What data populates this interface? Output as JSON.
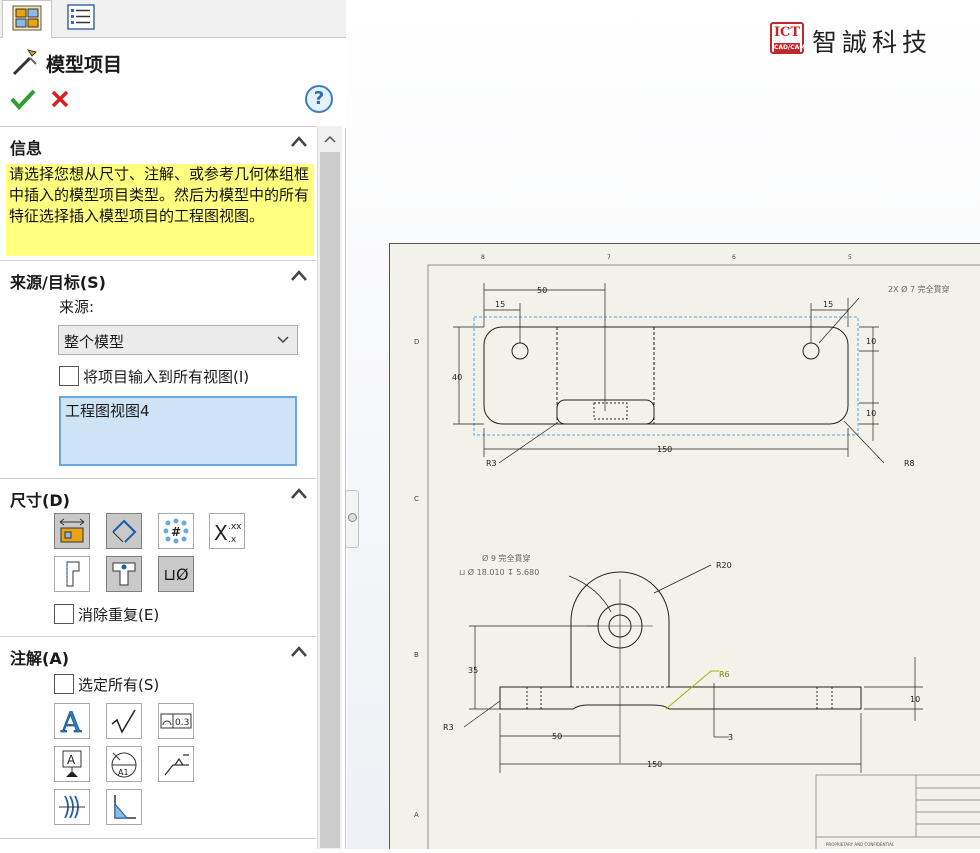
{
  "tabs": [
    {
      "name": "feature-manager-tab",
      "icon": "feature-manager-icon"
    },
    {
      "name": "property-manager-tab",
      "icon": "property-manager-icon"
    }
  ],
  "header": {
    "title": "模型项目",
    "help_label": "?",
    "ok_icon": "checkmark-icon",
    "cancel_icon": "close-icon"
  },
  "info": {
    "title": "信息",
    "text": "请选择您想从尺寸、注解、或参考几何体组框中插入的模型项目类型。然后为模型中的所有特征选择插入模型项目的工程图视图。"
  },
  "source": {
    "title": "来源/目标(S)",
    "source_label": "来源:",
    "source_value": "整个模型",
    "import_all_label": "将项目输入到所有视图(I)",
    "import_all_checked": false,
    "target_view": "工程图视图4"
  },
  "dimensions": {
    "title": "尺寸(D)",
    "eliminate_dup_label": "消除重复(E)",
    "eliminate_dup_checked": false,
    "tools": [
      {
        "name": "marked-for-drawing-icon",
        "active": true
      },
      {
        "name": "not-marked-for-drawing-icon",
        "active": true
      },
      {
        "name": "instance-count-icon",
        "active": false
      },
      {
        "name": "tolerance-dimension-icon",
        "label": "X.xx",
        "active": false
      },
      {
        "name": "hole-wizard-profile-icon",
        "active": false
      },
      {
        "name": "hole-wizard-locations-icon",
        "active": true
      },
      {
        "name": "hole-callout-icon",
        "label": "⊔Ø",
        "active": true
      }
    ]
  },
  "annotations": {
    "title": "注解(A)",
    "select_all_label": "选定所有(S)",
    "select_all_checked": false,
    "tools": [
      {
        "name": "note-icon"
      },
      {
        "name": "surface-finish-icon"
      },
      {
        "name": "geometric-tolerance-icon",
        "label": "0.3"
      },
      {
        "name": "datum-feature-icon",
        "label": "A"
      },
      {
        "name": "datum-target-icon",
        "label": "A1"
      },
      {
        "name": "weld-symbol-icon"
      },
      {
        "name": "cosmetic-thread-icon"
      },
      {
        "name": "weld-bead-icon"
      }
    ]
  },
  "logo": {
    "badge": "ICT",
    "badge_sub": "CAD/CAM",
    "company": "智誠科技"
  },
  "drawing": {
    "zone_letters": [
      "D",
      "C",
      "B",
      "A"
    ],
    "zone_numbers": [
      "8",
      "7",
      "6",
      "5"
    ],
    "top_view": {
      "dims": [
        "50",
        "15",
        "15",
        "40",
        "10",
        "10",
        "150"
      ],
      "radius_left": "R3",
      "radius_right": "R8",
      "hole_note": "2X Ø 7 完全貫穿"
    },
    "front_view": {
      "hole_note_1": "Ø 9 完全貫穿",
      "hole_note_2": "⊔ Ø 18.010 ↧ 5.680",
      "radius_top": "R20",
      "radius_fillet": "R6",
      "radius_left": "R3",
      "dims": [
        "35",
        "10",
        "50",
        "3",
        "150"
      ]
    },
    "title_block_text": "PROPRIETARY AND CONFIDENTIAL"
  },
  "colors": {
    "info_bg": "#ffff80",
    "ok_green": "#2f9e2f",
    "cancel_red": "#d62020",
    "selection_blue": "#cfe3f7",
    "sheet": "#f2f2ea",
    "leader_yellow": "#a8b400"
  }
}
